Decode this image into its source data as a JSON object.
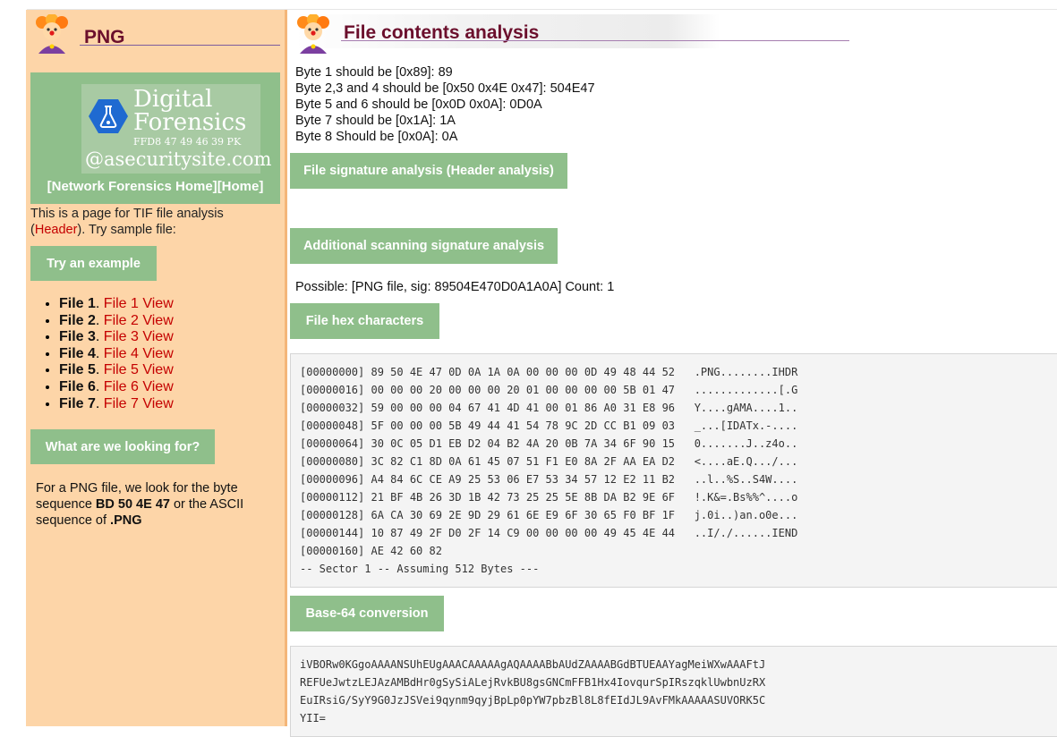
{
  "sidebar": {
    "title": "PNG",
    "logo": {
      "line1": "Digital",
      "line2": "Forensics",
      "hex": "FFD8 47 49 46 39 PK",
      "site": "@asecuritysite.com"
    },
    "links": {
      "network_home": "[Network Forensics Home]",
      "home": "[Home]"
    },
    "intro": {
      "before": "This is a page for TIF file analysis (",
      "header_link": "Header",
      "after": "). Try sample file:"
    },
    "try_button": "Try an example",
    "files": [
      {
        "label": "File 1",
        "link": "File 1 View"
      },
      {
        "label": "File 2",
        "link": "File 2 View"
      },
      {
        "label": "File 3",
        "link": "File 3 View"
      },
      {
        "label": "File 4",
        "link": "File 4 View"
      },
      {
        "label": "File 5",
        "link": "File 5 View"
      },
      {
        "label": "File 6",
        "link": "File 6 View"
      },
      {
        "label": "File 7",
        "link": "File 7 View"
      }
    ],
    "looking_button": "What are we looking for?",
    "desc": {
      "p1": "For a PNG file, we look for the byte sequence ",
      "bytes": "BD 50 4E 47",
      "p2": " or the ASCII sequence of ",
      "ascii": ".PNG"
    }
  },
  "main": {
    "title": "File contents analysis",
    "byte_lines": [
      "Byte 1 should be [0x89]: 89",
      "Byte 2,3 and 4 should be [0x50 0x4E 0x47]: 504E47",
      "Byte 5 and 6 should be [0x0D 0x0A]: 0D0A",
      "Byte 7 should be [0x1A]: 1A",
      "Byte 8 Should be [0x0A]: 0A"
    ],
    "sig_button": "File signature analysis (Header analysis)",
    "scan_button": "Additional scanning signature analysis",
    "possible": "Possible: [PNG file, sig: 89504E470D0A1A0A] Count: 1",
    "hex_button": "File hex characters",
    "hex_lines": [
      "[00000000] 89 50 4E 47 0D 0A 1A 0A 00 00 00 0D 49 48 44 52   .PNG........IHDR",
      "[00000016] 00 00 00 20 00 00 00 20 01 00 00 00 00 5B 01 47   .............[.G",
      "[00000032] 59 00 00 00 04 67 41 4D 41 00 01 86 A0 31 E8 96   Y....gAMA....1..",
      "[00000048] 5F 00 00 00 5B 49 44 41 54 78 9C 2D CC B1 09 03   _...[IDATx.-....",
      "[00000064] 30 0C 05 D1 EB D2 04 B2 4A 20 0B 7A 34 6F 90 15   0.......J..z4o..",
      "[00000080] 3C 82 C1 8D 0A 61 45 07 51 F1 E0 8A 2F AA EA D2   <....aE.Q.../...",
      "[00000096] A4 84 6C CE A9 25 53 06 E7 53 34 57 12 E2 11 B2   ..l..%S..S4W....",
      "[00000112] 21 BF 4B 26 3D 1B 42 73 25 25 5E 8B DA B2 9E 6F   !.K&=.Bs%%^....o",
      "[00000128] 6A CA 30 69 2E 9D 29 61 6E E9 6F 30 65 F0 BF 1F   j.0i..)an.o0e...",
      "[00000144] 10 87 49 2F D0 2F 14 C9 00 00 00 00 49 45 4E 44   ..I/./......IEND",
      "[00000160] AE 42 60 82",
      "-- Sector 1 -- Assuming 512 Bytes ---"
    ],
    "b64_button": "Base-64 conversion",
    "b64_lines": [
      "iVBORw0KGgoAAAANSUhEUgAAACAAAAAgAQAAAABbAUdZAAAABGdBTUEAAYagMeiWXwAAAFtJ",
      "REFUeJwtzLEJAzAMBdHr0gSySiALejRvkBU8gsGNCmFFB1Hx4IovqurSpIRszqklUwbnUzRX",
      "EuIRsiG/SyY9G0JzJSVei9qynm9qyjBpLp0pYW7pbzBl8L8fEIdJL9AvFMkAAAAASUVORK5C",
      "YII="
    ]
  }
}
